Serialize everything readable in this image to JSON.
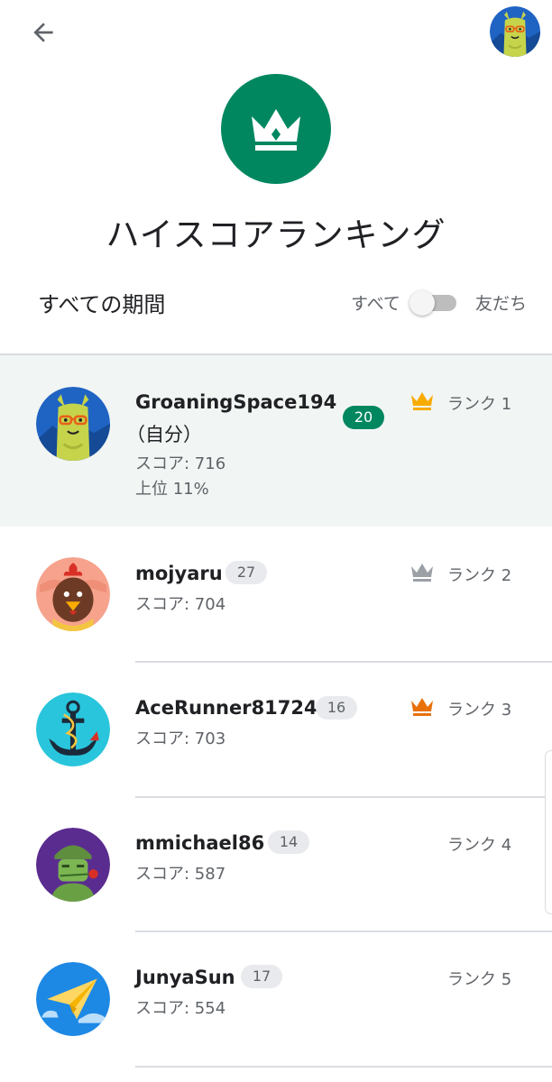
{
  "header": {
    "title": "ハイスコアランキング"
  },
  "filters": {
    "period_label": "すべての期間",
    "toggle_left_label": "すべて",
    "toggle_right_label": "友だち",
    "toggle_state": "すべて"
  },
  "icons": {
    "back": "arrow-back-icon",
    "crown": "crown-icon"
  },
  "colors": {
    "accent": "#01875f",
    "gold": "#f9ab00",
    "silver": "#9aa0a6",
    "bronze": "#e8710a"
  },
  "players": [
    {
      "name": "GroaningSpace194",
      "self_tag": "（自分）",
      "level": "20",
      "score": "スコア: 716",
      "percentile": "上位 11%",
      "rank": "ランク 1",
      "crown": "gold"
    },
    {
      "name": "mojyaru",
      "level": "27",
      "score": "スコア: 704",
      "rank": "ランク 2",
      "crown": "silver"
    },
    {
      "name": "AceRunner81724",
      "level": "16",
      "score": "スコア: 703",
      "rank": "ランク 3",
      "crown": "bronze"
    },
    {
      "name": "mmichael86",
      "level": "14",
      "score": "スコア: 587",
      "rank": "ランク 4"
    },
    {
      "name": "JunyaSun",
      "level": "17",
      "score": "スコア: 554",
      "rank": "ランク 5"
    }
  ]
}
